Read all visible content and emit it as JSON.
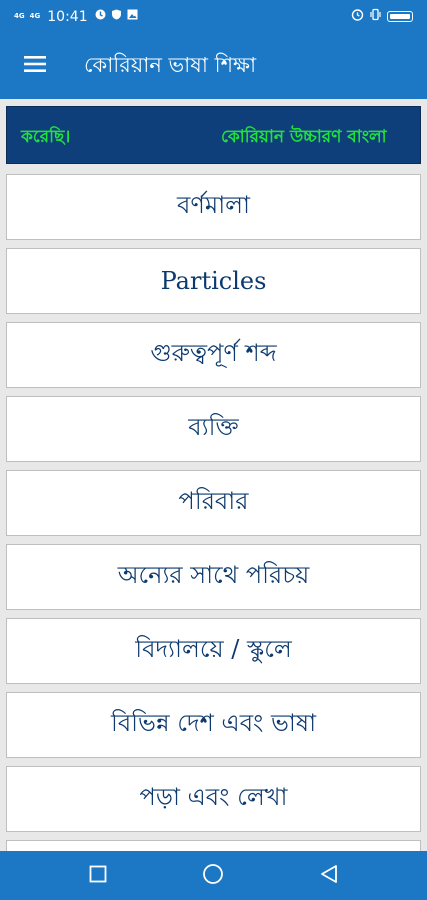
{
  "status_bar": {
    "network_1": "4G",
    "network_2": "4G",
    "time": "10:41",
    "icons_left": [
      "notification-icon",
      "shield-icon",
      "gallery-icon"
    ],
    "icons_right": [
      "alarm-icon",
      "vibrate-icon",
      "battery-icon"
    ]
  },
  "app_bar": {
    "menu_icon": "menu-icon",
    "title": "কোরিয়ান ভাষা শিক্ষা"
  },
  "ticker": {
    "left_text": "করেছি।",
    "right_text": "কোরিয়ান উচ্চারণ বাংলা"
  },
  "menu_items": [
    {
      "label": "বর্ণমালা"
    },
    {
      "label": "Particles"
    },
    {
      "label": "গুরুত্বপূর্ণ শব্দ"
    },
    {
      "label": "ব্যক্তি"
    },
    {
      "label": "পরিবার"
    },
    {
      "label": "অন্যের সাথে পরিচয়"
    },
    {
      "label": "বিদ্যালয়ে / স্কুলে"
    },
    {
      "label": "বিভিন্ন দেশ এবং ভাষা"
    },
    {
      "label": "পড়া এবং লেখা"
    }
  ],
  "nav_bar": {
    "buttons": [
      "recent-apps-icon",
      "home-icon",
      "back-icon"
    ]
  },
  "colors": {
    "primary": "#1c78c4",
    "ticker_bg": "#0e3f7b",
    "ticker_text": "#20e03c",
    "item_text": "#0d3a6e"
  }
}
